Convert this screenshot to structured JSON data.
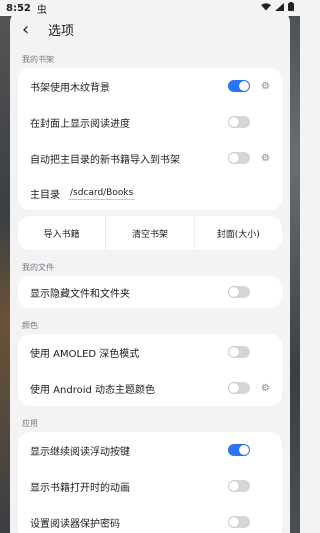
{
  "status": {
    "time": "8:52",
    "bug_glyph": "虫"
  },
  "header": {
    "title": "选项",
    "back_glyph": "‹"
  },
  "sections": {
    "shelf": {
      "label": "我的书架",
      "items": [
        {
          "label": "书架使用木纹背景",
          "switch": true,
          "gear": true
        },
        {
          "label": "在封面上显示阅读进度",
          "switch": false,
          "gear": false
        },
        {
          "label": "自动把主目录的新书籍导入到书架",
          "switch": false,
          "gear": true
        }
      ],
      "dir_label": "主目录",
      "dir_value": "/sdcard/Books",
      "buttons": [
        "导入书籍",
        "清空书架",
        "封面(大小)"
      ]
    },
    "files": {
      "label": "我的文件",
      "items": [
        {
          "label": "显示隐藏文件和文件夹",
          "switch": false
        }
      ]
    },
    "colors": {
      "label": "颜色",
      "items": [
        {
          "label": "使用 AMOLED 深色模式",
          "switch": false,
          "gear": false
        },
        {
          "label": "使用 Android 动态主题颜色",
          "switch": false,
          "gear": true
        }
      ]
    },
    "app": {
      "label": "应用",
      "items": [
        {
          "label": "显示继续阅读浮动按键",
          "switch": true
        },
        {
          "label": "显示书籍打开时的动画",
          "switch": false
        },
        {
          "label": "设置阅读器保护密码",
          "switch": false
        }
      ]
    }
  },
  "colors": {
    "accent": "#2b74f5",
    "switch_off": "#d6d6da"
  }
}
